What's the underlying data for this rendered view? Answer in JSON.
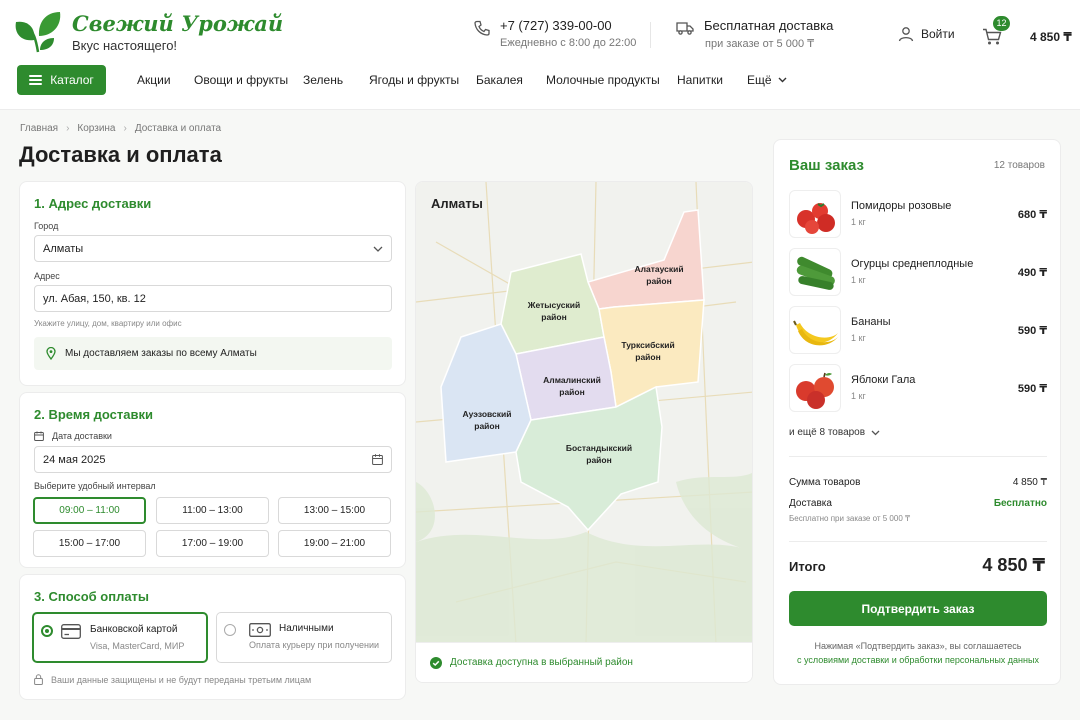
{
  "brand": {
    "name": "Свежий Урожай",
    "tagline": "Вкус настоящего!"
  },
  "header": {
    "phone": "+7 (727) 339-00-00",
    "hours": "Ежедневно с 8:00 до 22:00",
    "delivery_title": "Бесплатная доставка",
    "delivery_sub": "при заказе от 5 000 ₸",
    "login": "Войти",
    "cart_count": "12",
    "cart_total": "4 850 ₸"
  },
  "nav": {
    "catalog": "Каталог",
    "items": [
      "Акции",
      "Овощи и фрукты",
      "Зелень",
      "Ягоды и фрукты",
      "Бакалея",
      "Молочные продукты",
      "Напитки",
      "Ещё"
    ]
  },
  "breadcrumbs": [
    "Главная",
    "Корзина",
    "Доставка и оплата"
  ],
  "page_title": "Доставка и оплата",
  "address": {
    "title": "1. Адрес доставки",
    "city_label": "Город",
    "city_value": "Алматы",
    "address_label": "Адрес",
    "address_value": "ул. Абая, 150, кв. 12",
    "address_hint": "Укажите улицу, дом, квартиру или офис",
    "info": "Мы доставляем заказы по всему Алматы"
  },
  "time": {
    "title": "2. Время доставки",
    "date_label": "Дата доставки",
    "date_value": "24 мая 2025",
    "interval_label": "Выберите удобный интервал",
    "slots": [
      "09:00 – 11:00",
      "11:00 – 13:00",
      "13:00 – 15:00",
      "15:00 – 17:00",
      "17:00 – 19:00",
      "19:00 – 21:00"
    ],
    "selected_slot": "09:00 – 11:00"
  },
  "payment": {
    "title": "3. Способ оплаты",
    "card_title": "Банковской картой",
    "card_sub": "Visa, MasterCard, МИР",
    "cash_title": "Наличными",
    "cash_sub": "Оплата курьеру при получении",
    "selected": "card",
    "secure_note": "Ваши данные защищены и не будут переданы третьим лицам"
  },
  "map": {
    "city": "Алматы",
    "districts": {
      "alatau": [
        "Алатауский",
        "район"
      ],
      "zhetysu": [
        "Жетысуский",
        "район"
      ],
      "turksib": [
        "Турксибский",
        "район"
      ],
      "almaly": [
        "Алмалинский",
        "район"
      ],
      "auezov": [
        "Ауэзовский",
        "район"
      ],
      "bostandyk": [
        "Бостандыкский",
        "район"
      ]
    },
    "status": "Доставка доступна в выбранный район"
  },
  "order": {
    "title": "Ваш заказ",
    "count": "12 товаров",
    "items": [
      {
        "name": "Помидоры розовые",
        "qty": "1 кг",
        "price": "680 ₸"
      },
      {
        "name": "Огурцы среднеплодные",
        "qty": "1 кг",
        "price": "490 ₸"
      },
      {
        "name": "Бананы",
        "qty": "1 кг",
        "price": "590 ₸"
      },
      {
        "name": "Яблоки Гала",
        "qty": "1 кг",
        "price": "590 ₸"
      }
    ],
    "more": "и ещё 8 товаров",
    "subtotal_label": "Сумма товаров",
    "subtotal_value": "4 850 ₸",
    "delivery_label": "Доставка",
    "delivery_value": "Бесплатно",
    "delivery_note": "Бесплатно при заказе от 5 000 ₸",
    "total_label": "Итого",
    "total_value": "4 850 ₸",
    "confirm": "Подтвердить заказ",
    "agree_text": "Нажимая «Подтвердить заказ», вы соглашаетесь",
    "agree_link": "с условиями доставки и обработки персональных данных"
  },
  "colors": {
    "brand_green": "#2e8b2e",
    "background": "#f7f8f6"
  }
}
